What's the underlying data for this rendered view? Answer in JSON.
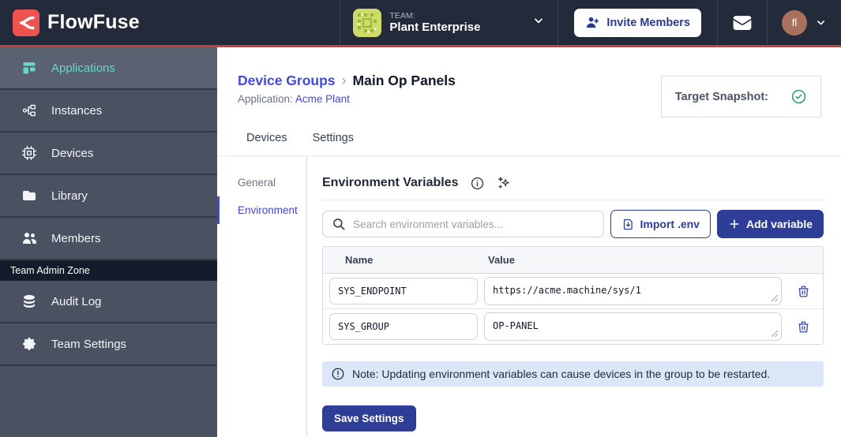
{
  "header": {
    "brand": "FlowFuse",
    "team": {
      "label": "TEAM:",
      "name": "Plant Enterprise"
    },
    "invite_button_label": "Invite Members",
    "user_initials": "fl"
  },
  "sidebar": {
    "items": [
      {
        "label": "Applications"
      },
      {
        "label": "Instances"
      },
      {
        "label": "Devices"
      },
      {
        "label": "Library"
      },
      {
        "label": "Members"
      }
    ],
    "admin_section_label": "Team Admin Zone",
    "admin_items": [
      {
        "label": "Audit Log"
      },
      {
        "label": "Team Settings"
      }
    ]
  },
  "page": {
    "breadcrumb": {
      "parent": "Device Groups",
      "separator": "›",
      "current": "Main Op Panels"
    },
    "application": {
      "label": "Application:",
      "name": "Acme Plant"
    },
    "target_snapshot_label": "Target Snapshot:",
    "tabs": [
      {
        "label": "Devices"
      },
      {
        "label": "Settings"
      }
    ],
    "settings_nav": [
      {
        "label": "General"
      },
      {
        "label": "Environment"
      }
    ]
  },
  "env_panel": {
    "title": "Environment Variables",
    "search_placeholder": "Search environment variables...",
    "import_button_label": "Import .env",
    "add_button_label": "Add variable",
    "table": {
      "columns": [
        "Name",
        "Value"
      ],
      "rows": [
        {
          "name": "SYS_ENDPOINT",
          "value": "https://acme.machine/sys/1"
        },
        {
          "name": "SYS_GROUP",
          "value": "OP-PANEL"
        }
      ]
    },
    "note": "Note: Updating environment variables can cause devices in the group to be restarted.",
    "save_button_label": "Save Settings"
  },
  "colors": {
    "accent_red": "#ce3c3c",
    "brand_indigo": "#2e3d96",
    "link_indigo": "#4348de",
    "active_teal": "#68d8c5",
    "note_bg": "#dbe7f8",
    "snapshot_check_green": "#2f9e6e"
  }
}
